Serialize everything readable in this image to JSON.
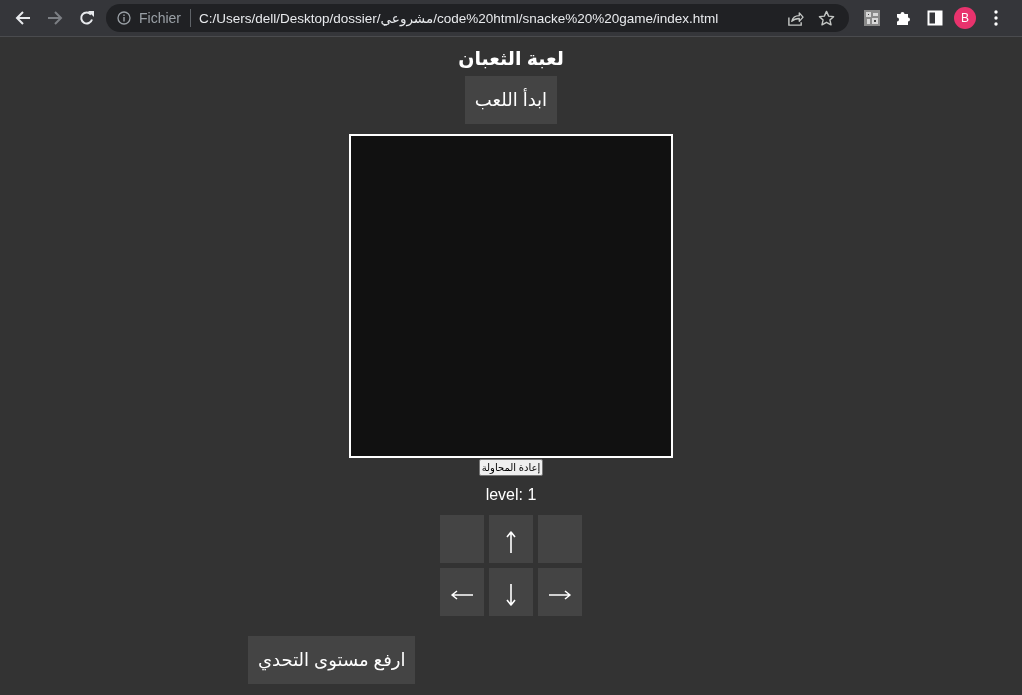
{
  "browser": {
    "nav_buttons": [
      {
        "kind": "back",
        "disabled": false
      },
      {
        "kind": "forward",
        "disabled": true
      },
      {
        "kind": "reload",
        "disabled": false
      }
    ],
    "address_bar": {
      "security_label": "Fichier",
      "url": "C:/Users/dell/Desktop/dossier/مشروعي/code%20html/snacke%20%20game/index.html"
    },
    "profile": {
      "initial": "B"
    }
  },
  "page": {
    "title": "لعبة الثعبان",
    "start_button": "ابدأ اللعب",
    "retry_button": "إعادة المحاولة",
    "level_label": "level: 1",
    "direction_pad": [
      {
        "kind": "blank"
      },
      {
        "kind": "up"
      },
      {
        "kind": "blank"
      },
      {
        "kind": "left"
      },
      {
        "kind": "down"
      },
      {
        "kind": "right"
      }
    ],
    "challenge_button": "ارفع مستوى التحدي"
  }
}
